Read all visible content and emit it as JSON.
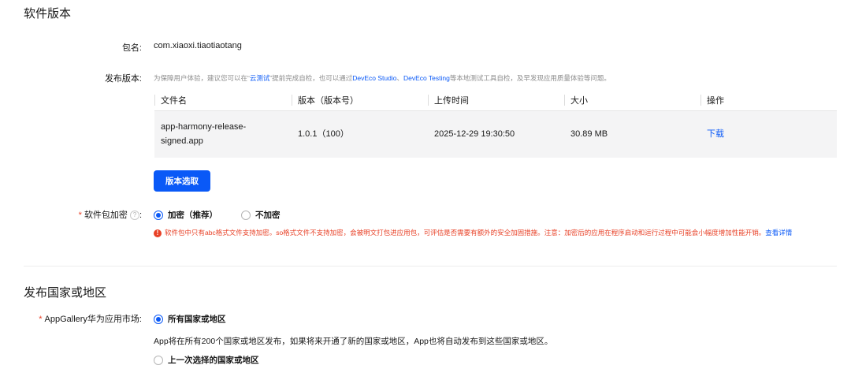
{
  "software_version": {
    "section_title": "软件版本",
    "package_label": "包名:",
    "package_name": "com.xiaoxi.tiaotiaotang",
    "release_label": "发布版本:",
    "hint_prefix": "为保障用户体验，建议您可以在“",
    "hint_link_cloud": "云测试",
    "hint_mid1": "”提前完成自检，也可以通过",
    "hint_link_studio": "DevEco Studio",
    "hint_sep": "、",
    "hint_link_testing": "DevEco Testing",
    "hint_suffix": "等本地测试工具自检，及早发现应用质量体验等问题。",
    "table": {
      "headers": [
        "文件名",
        "版本（版本号）",
        "上传时间",
        "大小",
        "操作"
      ],
      "rows": [
        {
          "file_name_line1": "app-harmony-release-",
          "file_name_line2": "signed.app",
          "version": "1.0.1（100）",
          "upload_time": "2025-12-29 19:30:50",
          "size": "30.89 MB",
          "action": "下载"
        }
      ]
    },
    "select_version_button": "版本选取",
    "encrypt_label": "软件包加密",
    "help_icon_glyph": "?",
    "encrypt_options": [
      {
        "label": "加密（推荐）",
        "checked": true
      },
      {
        "label": "不加密",
        "checked": false
      }
    ],
    "encrypt_warning": "软件包中只有abc格式文件支持加密。so格式文件不支持加密，会被明文打包进应用包，可评估是否需要有额外的安全加固措施。注意：加密后的应用在程序启动和运行过程中可能会小幅度增加性能开销。",
    "encrypt_warning_link": "查看详情",
    "error_icon_glyph": "!"
  },
  "regions": {
    "section_title": "发布国家或地区",
    "market_label": "AppGallery华为应用市场:",
    "option_all": "所有国家或地区",
    "option_all_desc": "App将在所有200个国家或地区发布，如果将来开通了新的国家或地区，App也将自动发布到这些国家或地区。",
    "option_last": "上一次选择的国家或地区"
  },
  "colors": {
    "primary": "#0a59f7",
    "required": "#e84026",
    "table_row_bg": "#f4f4f5"
  }
}
